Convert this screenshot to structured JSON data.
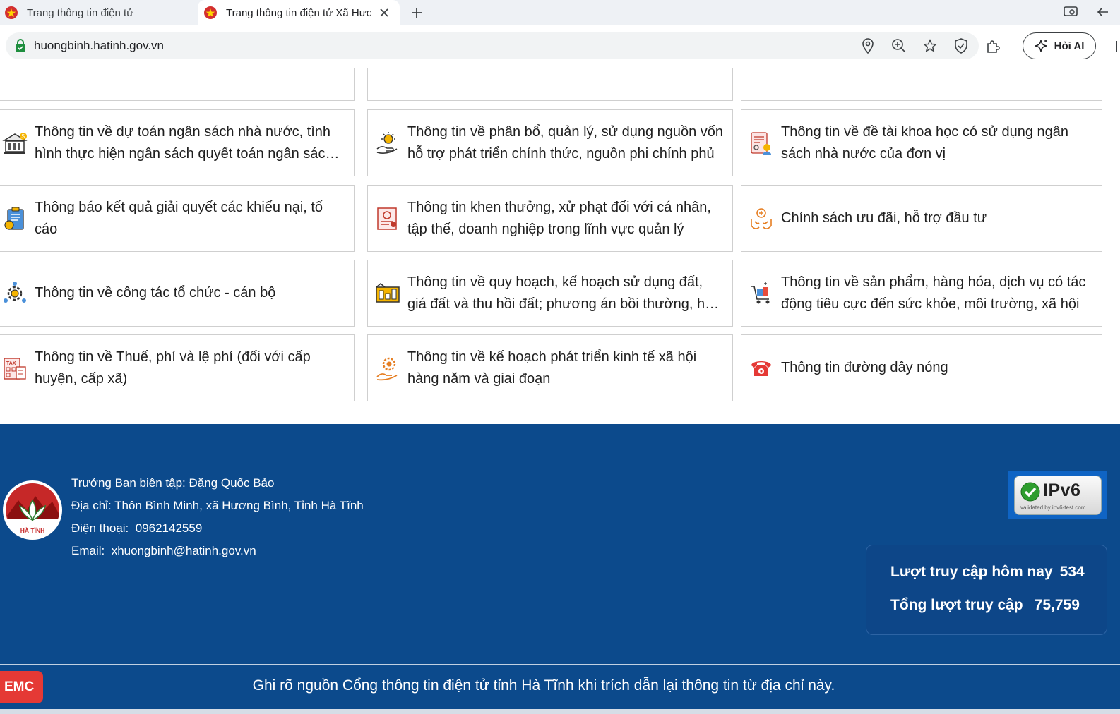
{
  "browser": {
    "tabs": [
      {
        "title": "Trang thông tin điện tử",
        "active": false
      },
      {
        "title": "Trang thông tin điện tử Xã Hươ",
        "active": true
      }
    ],
    "url": "huongbinh.hatinh.gov.vn",
    "ai_button_label": "Hỏi AI",
    "icons": [
      "location-icon",
      "zoom-icon",
      "star-icon",
      "shield-icon",
      "extensions-icon",
      "sparkle-icon"
    ]
  },
  "cards": [
    {
      "text": "Thông tin về dự toán ngân sách nhà nước, tình hình thực hiện ngân sách quyết toán ngân sách nhà nước",
      "icon": "budget-building-icon"
    },
    {
      "text": "Thông tin về phân bổ, quản lý, sử dụng nguồn vốn hỗ trợ phát triển chính thức, nguồn phi chính phủ",
      "icon": "funding-hand-icon"
    },
    {
      "text": "Thông tin về đề tài khoa học có sử dụng ngân sách nhà nước của đơn vị",
      "icon": "research-document-icon"
    },
    {
      "text": "Thông báo kết quả giải quyết các khiếu nại, tố cáo",
      "icon": "complaint-clipboard-icon"
    },
    {
      "text": "Thông tin khen thưởng, xử phạt đối với cá nhân, tập thể, doanh nghiệp trong lĩnh vực quản lý",
      "icon": "award-certificate-icon"
    },
    {
      "text": "Chính sách ưu đãi, hỗ trợ đầu tư",
      "icon": "investment-hands-icon"
    },
    {
      "text": "Thông tin về công tác tổ chức - cán bộ",
      "icon": "organization-gear-icon"
    },
    {
      "text": "Thông tin về quy hoạch, kế hoạch sử dụng đất, giá đất và thu hồi đất; phương án bồi thường, hỗ trợ",
      "icon": "land-planning-icon"
    },
    {
      "text": "Thông tin về sản phẩm, hàng hóa, dịch vụ có tác động tiêu cực đến sức khỏe, môi trường, xã hội",
      "icon": "product-cart-icon"
    },
    {
      "text": "Thông tin về Thuế, phí và lệ phí (đối với cấp huyện, cấp xã)",
      "icon": "tax-calculator-icon"
    },
    {
      "text": "Thông tin về kế hoạch phát triển kinh tế xã hội hàng năm và giai đoạn",
      "icon": "economic-development-icon"
    },
    {
      "text": "Thông tin đường dây nóng",
      "icon": "hotline-phone-icon"
    }
  ],
  "footer": {
    "editor_label": "Trưởng Ban biên tập:",
    "editor_name": "Đặng Quốc Bảo",
    "address_label": "Địa chỉ:",
    "address": "Thôn Bình Minh, xã Hương Bình, Tỉnh Hà Tĩnh",
    "phone_label": "Điện thoại:",
    "phone": "0962142559",
    "email_label": "Email:",
    "email": "xhuongbinh@hatinh.gov.vn",
    "logo_text": "HÀ TĨNH",
    "ipv6_label": "IPv6",
    "ipv6_sub": "validated by ipv6-test.com",
    "visits_today_label": "Lượt truy cập hôm nay",
    "visits_today": "534",
    "visits_total_label": "Tổng lượt truy cập",
    "visits_total": "75,759",
    "copyright": "Ghi rõ nguồn Cổng thông tin điện tử tỉnh Hà Tĩnh khi trích dẫn lại thông tin từ địa chỉ này.",
    "emc_label": "EMC"
  },
  "colors": {
    "footer_bg": "#0c4a8c",
    "accent_red": "#e53935",
    "card_border": "#cfcfcf"
  }
}
